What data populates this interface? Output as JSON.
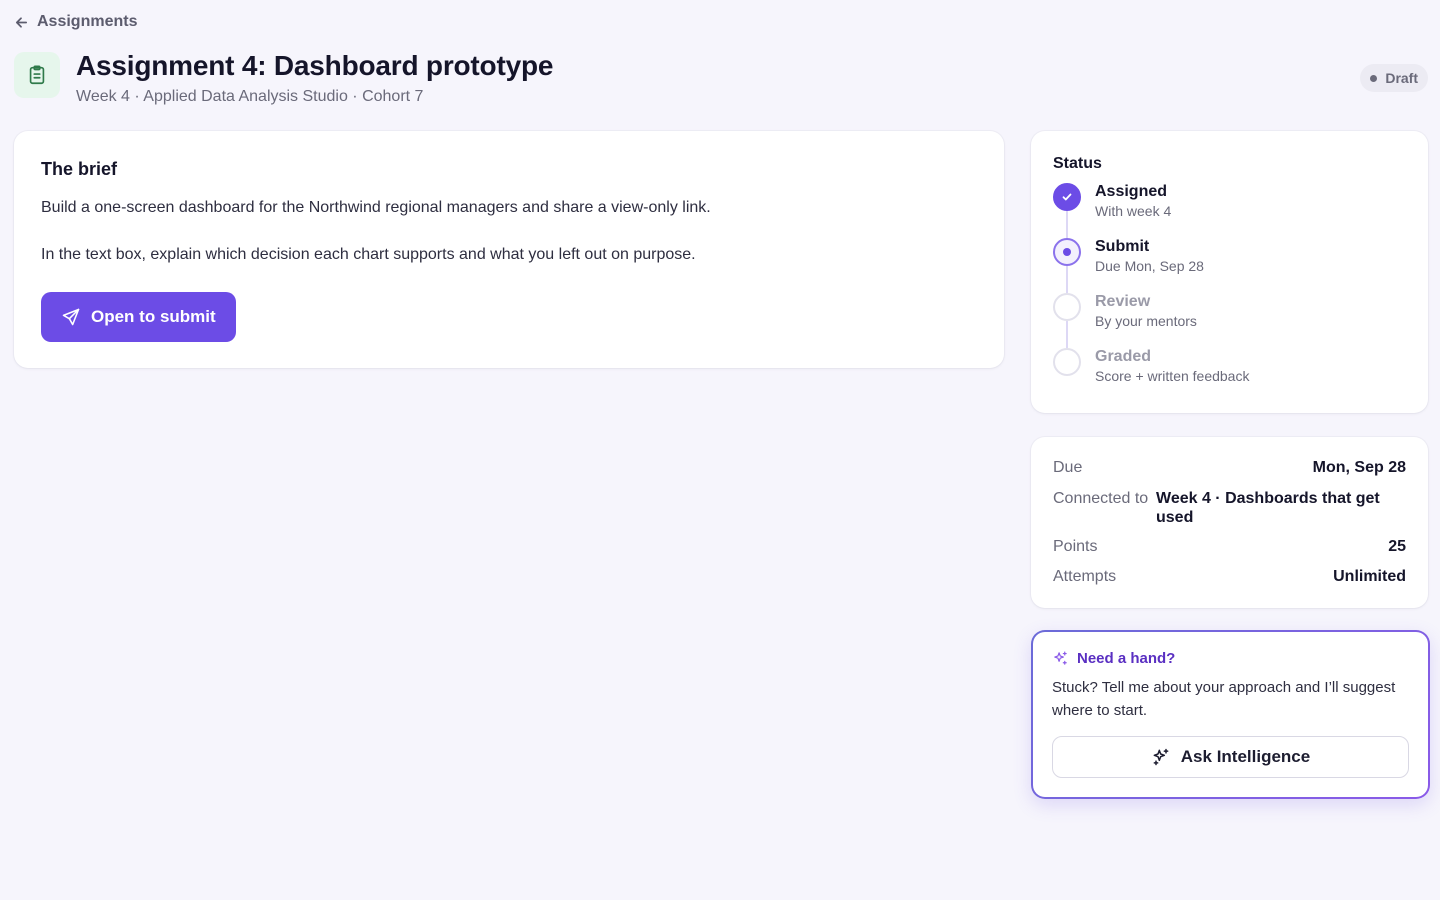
{
  "nav": {
    "back_label": "Assignments"
  },
  "header": {
    "title": "Assignment 4: Dashboard prototype",
    "subtitle": "Week 4 · Applied Data Analysis Studio · Cohort 7",
    "badge": "Draft"
  },
  "brief": {
    "heading": "The brief",
    "paragraph_1": "Build a one-screen dashboard for the Northwind regional managers and share a view-only link.",
    "paragraph_2": "In the text box, explain which decision each chart supports and what you left out on purpose.",
    "submit_label": "Open to submit"
  },
  "status": {
    "heading": "Status",
    "steps": [
      {
        "title": "Assigned",
        "detail": "With week 4",
        "state": "done"
      },
      {
        "title": "Submit",
        "detail": "Due Mon, Sep 28",
        "state": "current"
      },
      {
        "title": "Review",
        "detail": "By your mentors",
        "state": "pending"
      },
      {
        "title": "Graded",
        "detail": "Score + written feedback",
        "state": "pending"
      }
    ]
  },
  "details": {
    "due_label": "Due",
    "due_value": "Mon, Sep 28",
    "connected_label": "Connected to",
    "connected_value": "Week 4 · Dashboards that get used",
    "points_label": "Points",
    "points_value": "25",
    "attempts_label": "Attempts",
    "attempts_value": "Unlimited"
  },
  "help": {
    "title": "Need a hand?",
    "text": "Stuck? Tell me about your approach and I’ll suggest where to start.",
    "button_label": "Ask Intelligence"
  },
  "colors": {
    "accent": "#6c4ce6",
    "background": "#f6f5fc",
    "icon_bg": "#e6f6ec",
    "icon_fg": "#2f7a4a"
  },
  "icons": {
    "back": "arrow-left-icon",
    "header": "clipboard-icon",
    "submit": "send-icon",
    "step_done": "check-icon",
    "help": "sparkles-icon"
  }
}
